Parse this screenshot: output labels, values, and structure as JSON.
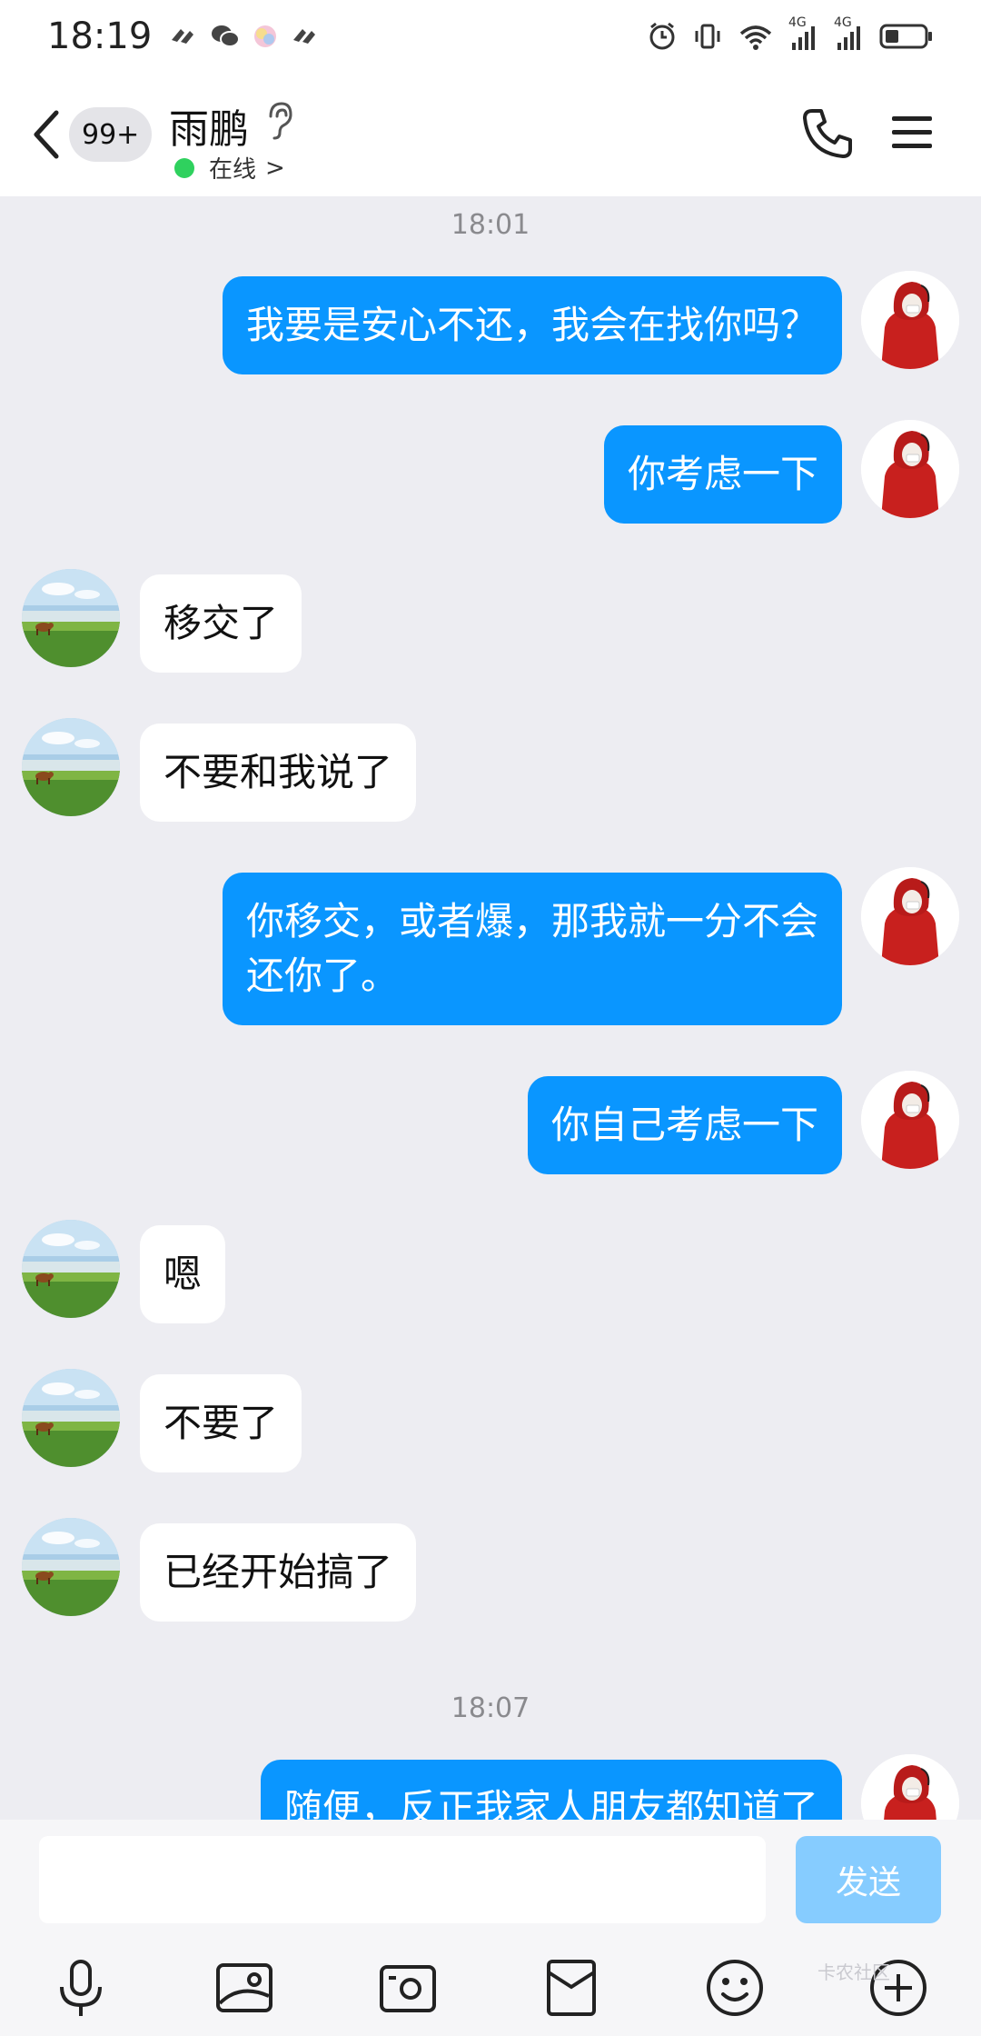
{
  "status_bar": {
    "time": "18:19",
    "network_left": "4G",
    "network_right": "4G"
  },
  "header": {
    "back_label": "返回",
    "unread_badge": "99+",
    "contact_name": "雨鹏",
    "presence": "在线",
    "presence_chevron": ">"
  },
  "messages": [
    {
      "type": "time",
      "text": "18:01"
    },
    {
      "type": "msg",
      "side": "me",
      "text": "我要是安心不还，我会在找你吗？"
    },
    {
      "type": "msg",
      "side": "me",
      "text": "你考虑一下"
    },
    {
      "type": "msg",
      "side": "them",
      "text": "移交了"
    },
    {
      "type": "msg",
      "side": "them",
      "text": "不要和我说了"
    },
    {
      "type": "msg",
      "side": "me",
      "text": "你移交，或者爆，那我就一分不会\n还你了。"
    },
    {
      "type": "msg",
      "side": "me",
      "text": "你自己考虑一下"
    },
    {
      "type": "msg",
      "side": "them",
      "text": "嗯"
    },
    {
      "type": "msg",
      "side": "them",
      "text": "不要了"
    },
    {
      "type": "msg",
      "side": "them",
      "text": "已经开始搞了"
    },
    {
      "type": "time",
      "text": "18:07"
    },
    {
      "type": "msg",
      "side": "me",
      "text": "随便，反正我家人朋友都知道了"
    }
  ],
  "input": {
    "placeholder": "",
    "send_label": "发送"
  },
  "toolbar": [
    "microphone-icon",
    "photo-icon",
    "camera-icon",
    "red-packet-icon",
    "emoji-icon",
    "plus-icon"
  ],
  "watermark": "卡农社区",
  "colors": {
    "my_bubble": "#0a96ff",
    "their_bubble": "#ffffff",
    "background": "#ededf2",
    "send_button": "#86ccff"
  }
}
